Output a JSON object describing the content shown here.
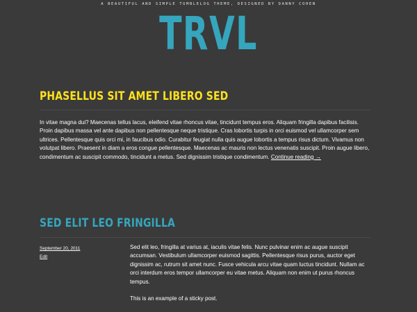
{
  "header": {
    "tagline": "A beautiful and simple tumblelog theme, designed by Danny Cohen",
    "site_title": "TRVL"
  },
  "post1": {
    "title": "Phasellus sit amet libero sed",
    "body": "In vitae magna dui? Maecenas tellus lacus, eleifend vitae rhoncus vitae, tincidunt tempus eros. Aliquam fringilla dapibus facilisis. Proin dapibus massa vel ante dapibus non pellentesque neque tristique. Cras lobortis turpis in orci euismod vel ullamcorper sem ultrices. Pellentesque quis orci mi, in faucibus odio. Curabitur feugiat nulla quis augue lobortis a tempus risus dictum. Vivamus non volutpat libero. Praesent in diam a eros congue pellentesque. Maecenas ac mauris non lectus venenatis suscipit. Proin augue libero, condimentum ac suscipit commodo, tincidunt a metus. Sed dignissim tristique condimentum.",
    "continue_label": "Continue reading →"
  },
  "post2": {
    "title": "Sed elit leo fringilla",
    "date": "September 20, 2011",
    "edit_label": "Edit",
    "paragraph1": "Sed elit leo, fringilla at varius at, iaculis vitae felis. Nunc pulvinar enim ac augue suscipit accumsan. Vestibulum ullamcorper euismod sagittis. Pellentesque risus purus, auctor eget dignissim ac, rutrum sit amet nunc. Fusce vehicula arcu vitae quam luctus tincidunt. Nullam ac orci interdum eros tempor ullamcorper eu vitae metus. Aliquam non enim ut purus rhoncus tempus.",
    "paragraph2": "This is an example of a sticky post."
  },
  "colors": {
    "background": "#3a3a3a",
    "accent_blue": "#35a6bd",
    "accent_yellow": "#ffe11c",
    "text": "#ffffff"
  }
}
